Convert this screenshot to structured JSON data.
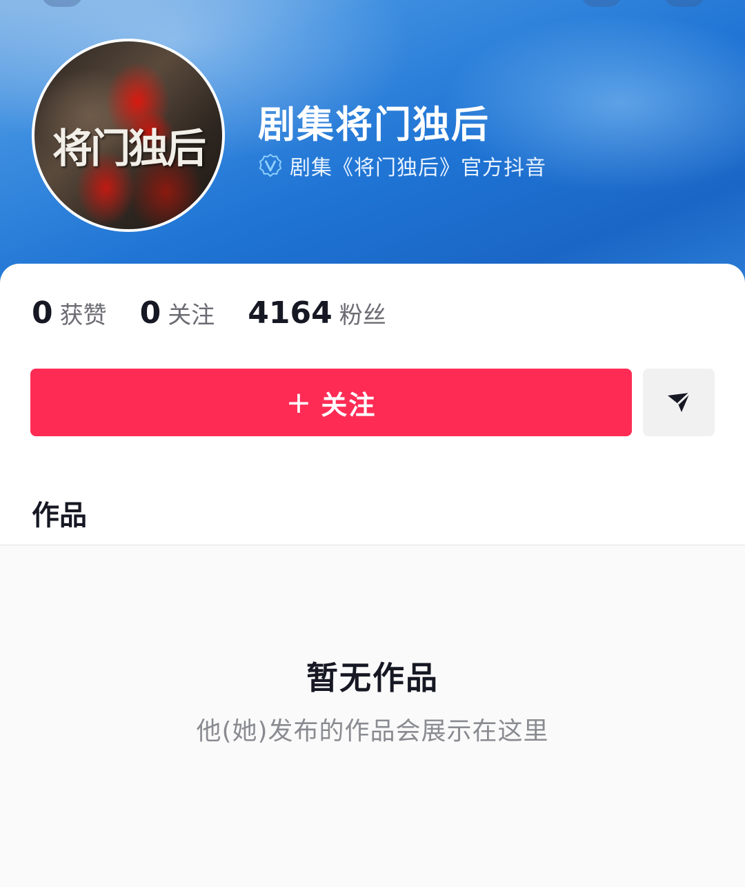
{
  "profile": {
    "avatar_text": "将门独后",
    "name": "剧集将门独后",
    "verified_icon": "verified-v-icon",
    "verified_text": "剧集《将门独后》官方抖音"
  },
  "stats": [
    {
      "value": "0",
      "label": "获赞"
    },
    {
      "value": "0",
      "label": "关注"
    },
    {
      "value": "4164",
      "label": "粉丝"
    }
  ],
  "actions": {
    "follow_plus": "+",
    "follow_label": "关注",
    "share_icon": "send-icon"
  },
  "tabs": {
    "works_label": "作品"
  },
  "empty_state": {
    "title": "暂无作品",
    "description": "他(她)发布的作品会展示在这里"
  },
  "colors": {
    "follow_button": "#fe2c55",
    "header_blue": "#1f74d4"
  }
}
